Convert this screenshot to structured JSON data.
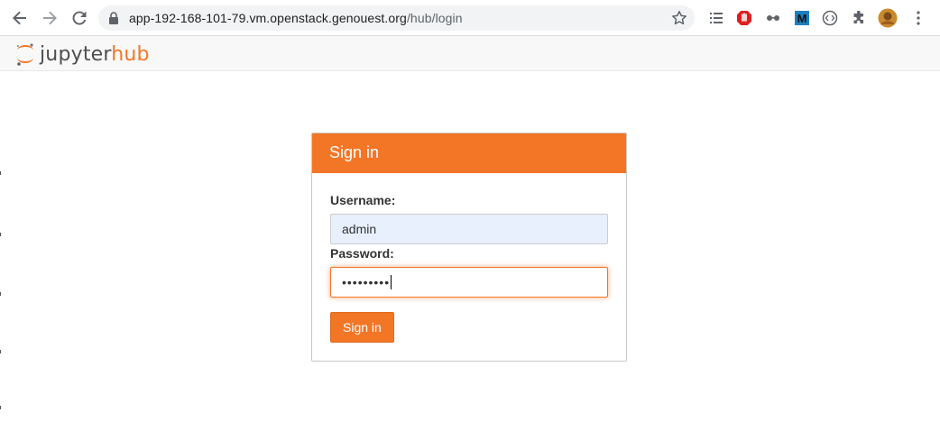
{
  "browser": {
    "url_host": "app-192-168-101-79.vm.openstack.genouest.org",
    "url_path": "/hub/login"
  },
  "header": {
    "logo_part1": "jupyter",
    "logo_part2": "hub"
  },
  "login": {
    "heading": "Sign in",
    "username_label": "Username:",
    "username_value": "admin",
    "password_label": "Password:",
    "password_mask": "•••••••••",
    "submit_label": "Sign in"
  },
  "colors": {
    "accent": "#f37626",
    "autofill_bg": "#e8f0fe",
    "header_bg": "#f8f8f8"
  },
  "icons": [
    "back-arrow-icon",
    "forward-arrow-icon",
    "reload-icon",
    "lock-icon",
    "star-icon",
    "reading-list-icon",
    "adblock-icon",
    "glasses-icon",
    "m-extension-icon",
    "code-extension-icon",
    "puzzle-icon",
    "profile-avatar",
    "menu-dots-icon"
  ]
}
